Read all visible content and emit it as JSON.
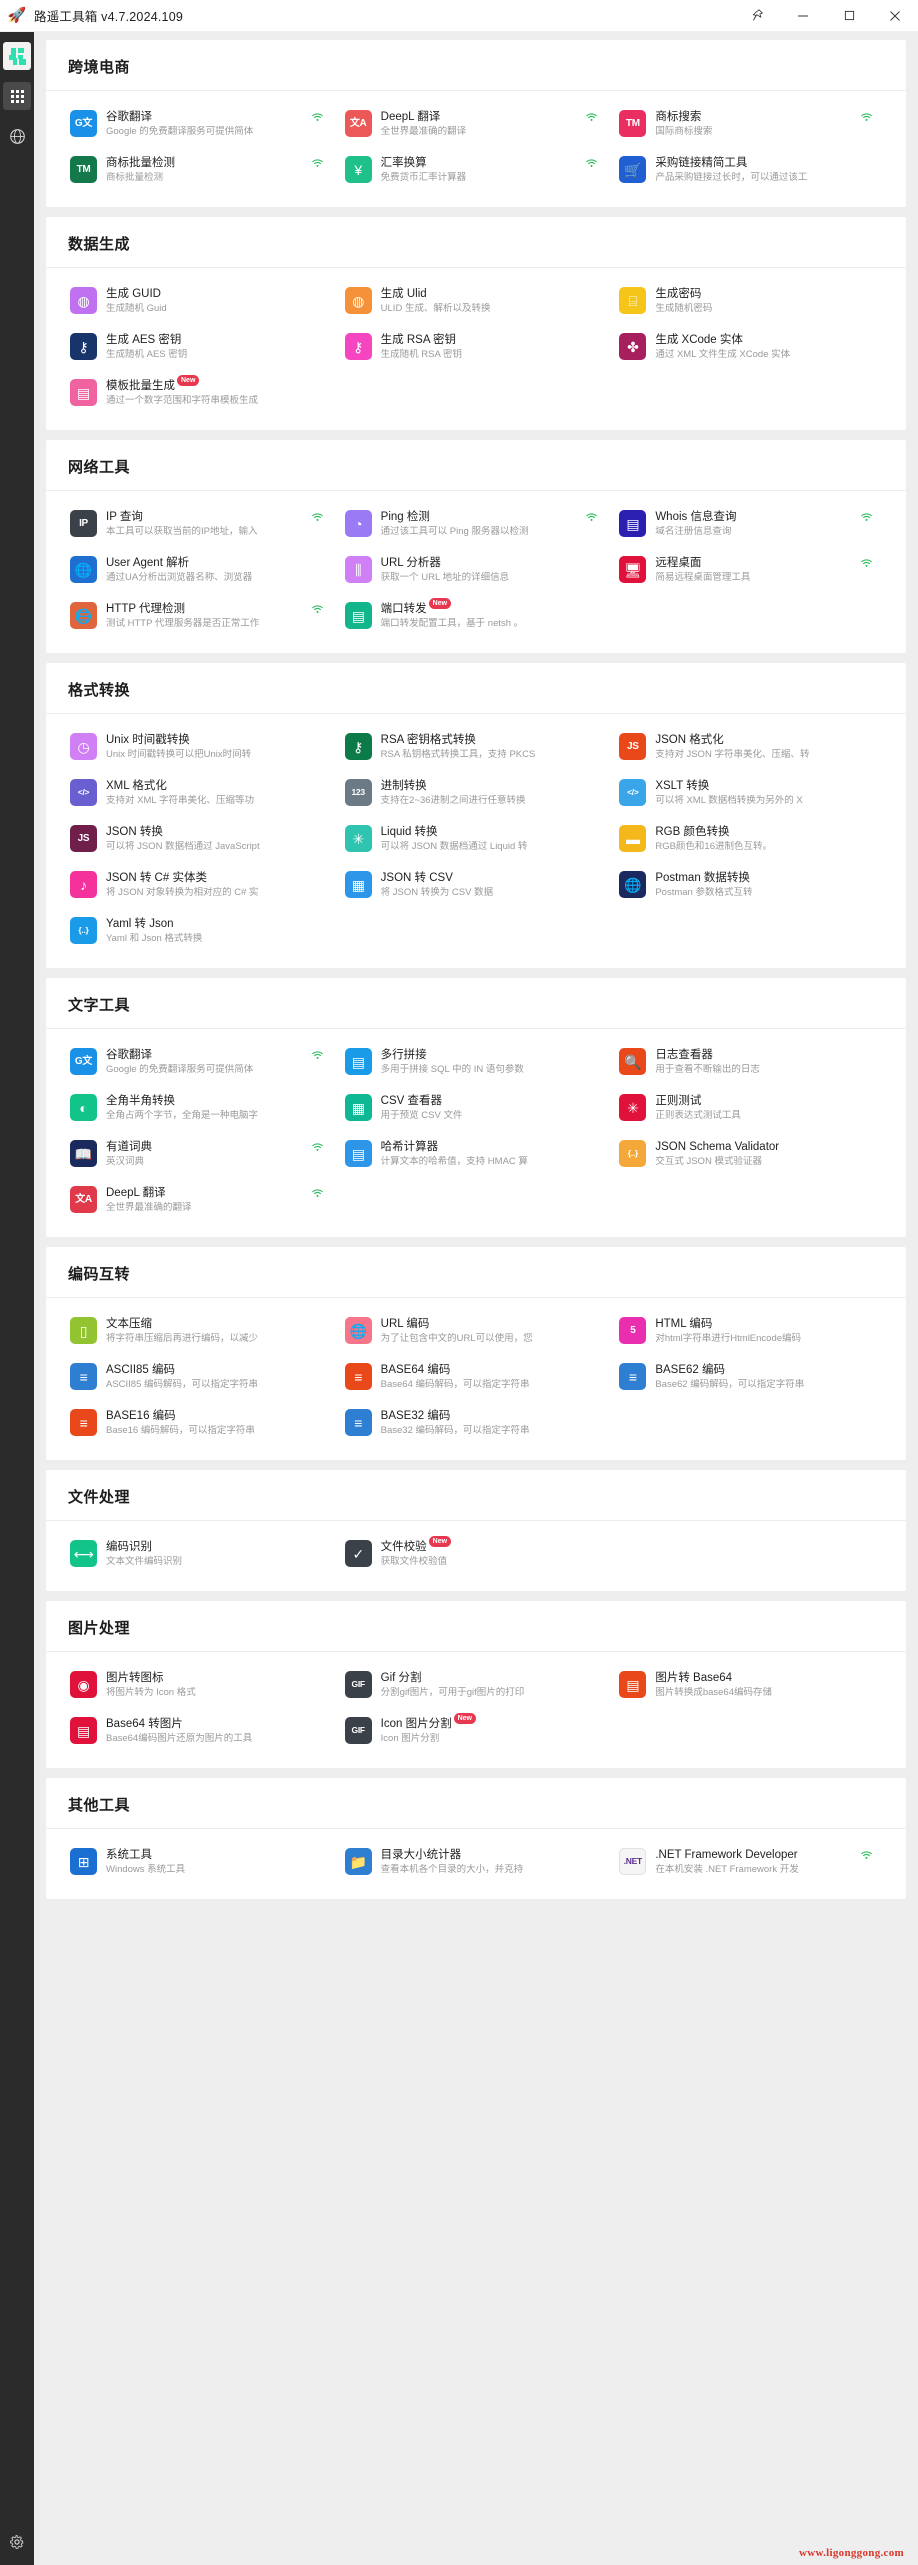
{
  "window": {
    "title": "路遥工具箱 v4.7.2024.109",
    "app_icon": "rocket-icon",
    "controls": {
      "pin": "pin-icon",
      "minimize": "minimize-icon",
      "maximize": "maximize-icon",
      "close": "close-icon"
    }
  },
  "sidebar": {
    "items": [
      {
        "name": "toolbox-logo",
        "icon": "puzzle-icon",
        "active": true
      },
      {
        "name": "all-tools",
        "icon": "grid-icon",
        "active": false
      },
      {
        "name": "web-tools",
        "icon": "globe-icon",
        "active": false
      }
    ],
    "settings": {
      "name": "settings",
      "icon": "gear-icon"
    }
  },
  "watermark": "www.ligonggong.com",
  "sections": [
    {
      "id": "cross-border-ecommerce",
      "title": "跨境电商",
      "cards": [
        {
          "title": "谷歌翻译",
          "desc": "Google 的免费翻译服务可提供简体",
          "icon": "google-translate-icon",
          "icon_text": "G文",
          "bg": "#1a91e6",
          "wifi": true
        },
        {
          "title": "DeepL 翻译",
          "desc": "全世界最准确的翻译",
          "icon": "translate-icon",
          "icon_text": "文A",
          "bg": "#ec5858",
          "wifi": true
        },
        {
          "title": "商标搜索",
          "desc": "国际商标搜索",
          "icon": "trademark-icon",
          "icon_text": "TM",
          "bg": "#ea2e62",
          "wifi": true
        },
        {
          "title": "商标批量检测",
          "desc": "商标批量检测",
          "icon": "trademark-batch-icon",
          "icon_text": "TM",
          "bg": "#13794a",
          "wifi": true
        },
        {
          "title": "汇率换算",
          "desc": "免费货币汇率计算器",
          "icon": "currency-yen-icon",
          "icon_text": "¥",
          "bg": "#1fc08a",
          "wifi": true
        },
        {
          "title": "采购链接精简工具",
          "desc": "产品采购链接过长时，可以通过该工",
          "icon": "shopping-cart-icon",
          "icon_text": "🛒",
          "bg": "#1f5fd1",
          "wifi": false
        }
      ]
    },
    {
      "id": "data-generation",
      "title": "数据生成",
      "cards": [
        {
          "title": "生成 GUID",
          "desc": "生成随机 Guid",
          "icon": "guid-icon",
          "icon_text": "◍",
          "bg": "#c071f0",
          "wifi": false
        },
        {
          "title": "生成 Ulid",
          "desc": "ULID 生成、解析以及转换",
          "icon": "ulid-icon",
          "icon_text": "◍",
          "bg": "#f59138",
          "wifi": false
        },
        {
          "title": "生成密码",
          "desc": "生成随机密码",
          "icon": "password-icon",
          "icon_text": "⌸",
          "bg": "#f5c519",
          "wifi": false
        },
        {
          "title": "生成 AES 密钥",
          "desc": "生成随机 AES 密钥",
          "icon": "aes-key-icon",
          "icon_text": "⚷",
          "bg": "#17346b",
          "wifi": false
        },
        {
          "title": "生成 RSA 密钥",
          "desc": "生成随机 RSA 密钥",
          "icon": "rsa-key-icon",
          "icon_text": "⚷",
          "bg": "#f545c0",
          "wifi": false
        },
        {
          "title": "生成 XCode 实体",
          "desc": "通过 XML 文件生成 XCode 实体",
          "icon": "xcode-entity-icon",
          "icon_text": "✤",
          "bg": "#a81f5e",
          "wifi": false
        },
        {
          "title": "模板批量生成",
          "desc": "通过一个数字范围和字符串模板生成",
          "icon": "template-batch-icon",
          "icon_text": "▤",
          "bg": "#f062a0",
          "wifi": false,
          "badge": "New"
        }
      ]
    },
    {
      "id": "network-tools",
      "title": "网络工具",
      "cards": [
        {
          "title": "IP 查询",
          "desc": "本工具可以获取当前的IP地址，输入",
          "icon": "ip-lookup-icon",
          "icon_text": "IP",
          "bg": "#3b4148",
          "wifi": true
        },
        {
          "title": "Ping 检测",
          "desc": "通过该工具可以 Ping 服务器以检测",
          "icon": "ping-icon",
          "icon_text": "◔",
          "bg": "#9a7bf5",
          "wifi": true
        },
        {
          "title": "Whois 信息查询",
          "desc": "域名注册信息查询",
          "icon": "whois-icon",
          "icon_text": "▤",
          "bg": "#2a1fb0",
          "wifi": true
        },
        {
          "title": "User Agent 解析",
          "desc": "通过UA分析出浏览器名称、浏览器",
          "icon": "user-agent-icon",
          "icon_text": "🌐",
          "bg": "#1f6fd1",
          "wifi": false
        },
        {
          "title": "URL 分析器",
          "desc": "获取一个 URL 地址的详细信息",
          "icon": "url-analyzer-icon",
          "icon_text": "⫼",
          "bg": "#d07ff5",
          "wifi": false
        },
        {
          "title": "远程桌面",
          "desc": "简易远程桌面管理工具",
          "icon": "remote-desktop-icon",
          "icon_text": "🖥",
          "bg": "#e0113a",
          "wifi": true
        },
        {
          "title": "HTTP 代理检测",
          "desc": "测试 HTTP 代理服务器是否正常工作",
          "icon": "http-proxy-icon",
          "icon_text": "🌐",
          "bg": "#e0643c",
          "wifi": true
        },
        {
          "title": "端口转发",
          "desc": "端口转发配置工具，基于 netsh 。",
          "icon": "port-forward-icon",
          "icon_text": "▤",
          "bg": "#13b58a",
          "wifi": false,
          "badge": "New"
        }
      ]
    },
    {
      "id": "format-conversion",
      "title": "格式转换",
      "cards": [
        {
          "title": "Unix 时间戳转换",
          "desc": "Unix 时间戳转换可以把Unix时间转",
          "icon": "clock-icon",
          "icon_text": "◷",
          "bg": "#d07ff5",
          "wifi": false
        },
        {
          "title": "RSA 密钥格式转换",
          "desc": "RSA 私钥格式转换工具，支持 PKCS",
          "icon": "rsa-format-icon",
          "icon_text": "⚷",
          "bg": "#0d7a4a",
          "wifi": false
        },
        {
          "title": "JSON 格式化",
          "desc": "支持对 JSON 字符串美化、压缩、转",
          "icon": "json-format-icon",
          "icon_text": "JS",
          "bg": "#e8481a",
          "wifi": false
        },
        {
          "title": "XML 格式化",
          "desc": "支持对 XML 字符串美化、压缩等功",
          "icon": "xml-format-icon",
          "icon_text": "</>",
          "bg": "#6a5fd1",
          "wifi": false
        },
        {
          "title": "进制转换",
          "desc": "支持在2~36进制之间进行任意转换",
          "icon": "radix-icon",
          "icon_text": "123",
          "bg": "#6b7a85",
          "wifi": false
        },
        {
          "title": "XSLT 转换",
          "desc": "可以将 XML 数据档转换为另外的 X",
          "icon": "xslt-icon",
          "icon_text": "</>",
          "bg": "#3aa5e8",
          "wifi": false
        },
        {
          "title": "JSON 转换",
          "desc": "可以将 JSON 数据档通过 JavaScript",
          "icon": "json-convert-icon",
          "icon_text": "JS",
          "bg": "#701f4a",
          "wifi": false
        },
        {
          "title": "Liquid 转换",
          "desc": "可以将 JSON 数据档通过 Liquid 转",
          "icon": "liquid-icon",
          "icon_text": "✳",
          "bg": "#2ec4b0",
          "wifi": false
        },
        {
          "title": "RGB 颜色转换",
          "desc": "RGB颜色和16进制色互转。",
          "icon": "rgb-color-icon",
          "icon_text": "▬",
          "bg": "#f5b81a",
          "wifi": false
        },
        {
          "title": "JSON 转 C# 实体类",
          "desc": "将 JSON 对象转换为相对应的 C# 实",
          "icon": "json-csharp-icon",
          "icon_text": "♪",
          "bg": "#f5319b",
          "wifi": false
        },
        {
          "title": "JSON 转 CSV",
          "desc": "将 JSON 转换为 CSV 数据",
          "icon": "json-csv-icon",
          "icon_text": "▦",
          "bg": "#2e96e8",
          "wifi": false
        },
        {
          "title": "Postman 数据转换",
          "desc": "Postman 参数格式互转",
          "icon": "postman-icon",
          "icon_text": "🌐",
          "bg": "#1a2a5e",
          "wifi": false
        },
        {
          "title": "Yaml 转 Json",
          "desc": "Yaml 和 Json 格式转换",
          "icon": "yaml-json-icon",
          "icon_text": "{..}",
          "bg": "#1a9be8",
          "wifi": false
        }
      ]
    },
    {
      "id": "text-tools",
      "title": "文字工具",
      "cards": [
        {
          "title": "谷歌翻译",
          "desc": "Google 的免费翻译服务可提供简体",
          "icon": "google-translate-icon",
          "icon_text": "G文",
          "bg": "#1a91e6",
          "wifi": true
        },
        {
          "title": "多行拼接",
          "desc": "多用于拼接 SQL 中的 IN 语句参数",
          "icon": "multiline-join-icon",
          "icon_text": "▤",
          "bg": "#1a9be8",
          "wifi": false
        },
        {
          "title": "日志查看器",
          "desc": "用于查看不断输出的日志",
          "icon": "log-viewer-icon",
          "icon_text": "🔍",
          "bg": "#e8481a",
          "wifi": false
        },
        {
          "title": "全角半角转换",
          "desc": "全角占两个字节，全角是一种电脑字",
          "icon": "fullwidth-icon",
          "icon_text": "◐",
          "bg": "#13c48a",
          "wifi": false
        },
        {
          "title": "CSV 查看器",
          "desc": "用于预览 CSV 文件",
          "icon": "csv-viewer-icon",
          "icon_text": "▦",
          "bg": "#0fb894",
          "wifi": false
        },
        {
          "title": "正则测试",
          "desc": "正则表达式测试工具",
          "icon": "regex-icon",
          "icon_text": "✳",
          "bg": "#e0113a",
          "wifi": false
        },
        {
          "title": "有道词典",
          "desc": "英汉词典",
          "icon": "dictionary-icon",
          "icon_text": "📖",
          "bg": "#1a2a5e",
          "wifi": true
        },
        {
          "title": "哈希计算器",
          "desc": "计算文本的哈希值，支持 HMAC 算",
          "icon": "hash-calc-icon",
          "icon_text": "▤",
          "bg": "#2e96e8",
          "wifi": false
        },
        {
          "title": "JSON Schema Validator",
          "desc": "交互式 JSON 模式验证器",
          "icon": "json-schema-icon",
          "icon_text": "{..}",
          "bg": "#f5a83a",
          "wifi": false
        },
        {
          "title": "DeepL 翻译",
          "desc": "全世界最准确的翻译",
          "icon": "translate-icon",
          "icon_text": "文A",
          "bg": "#e03a4a",
          "wifi": true
        }
      ]
    },
    {
      "id": "encoding-conversion",
      "title": "编码互转",
      "cards": [
        {
          "title": "文本压缩",
          "desc": "将字符串压缩后再进行编码，以减少",
          "icon": "text-compress-icon",
          "icon_text": "▯",
          "bg": "#92c432",
          "wifi": false
        },
        {
          "title": "URL 编码",
          "desc": "为了让包含中文的URL可以使用，您",
          "icon": "url-encode-icon",
          "icon_text": "🌐",
          "bg": "#f5768a",
          "wifi": false
        },
        {
          "title": "HTML 编码",
          "desc": "对html字符串进行HtmlEncode编码",
          "icon": "html-encode-icon",
          "icon_text": "5",
          "bg": "#ea2eb0",
          "wifi": false
        },
        {
          "title": "ASCII85 编码",
          "desc": "ASCII85 编码解码，可以指定字符串",
          "icon": "ascii85-icon",
          "icon_text": "≡",
          "bg": "#2e7fd1",
          "wifi": false
        },
        {
          "title": "BASE64 编码",
          "desc": "Base64 编码解码，可以指定字符串",
          "icon": "base64-icon",
          "icon_text": "≡",
          "bg": "#e8481a",
          "wifi": false
        },
        {
          "title": "BASE62 编码",
          "desc": "Base62 编码解码，可以指定字符串",
          "icon": "base62-icon",
          "icon_text": "≡",
          "bg": "#2e7fd1",
          "wifi": false
        },
        {
          "title": "BASE16 编码",
          "desc": "Base16 编码解码，可以指定字符串",
          "icon": "base16-icon",
          "icon_text": "≡",
          "bg": "#e8481a",
          "wifi": false
        },
        {
          "title": "BASE32 编码",
          "desc": "Base32 编码解码，可以指定字符串",
          "icon": "base32-icon",
          "icon_text": "≡",
          "bg": "#2e7fd1",
          "wifi": false
        }
      ]
    },
    {
      "id": "file-processing",
      "title": "文件处理",
      "cards": [
        {
          "title": "编码识别",
          "desc": "文本文件编码识别",
          "icon": "encoding-detect-icon",
          "icon_text": "⟷",
          "bg": "#13c48a",
          "wifi": false
        },
        {
          "title": "文件校验",
          "desc": "获取文件校验值",
          "icon": "file-checksum-icon",
          "icon_text": "✓",
          "bg": "#3b4148",
          "wifi": false,
          "badge": "New"
        }
      ]
    },
    {
      "id": "image-processing",
      "title": "图片处理",
      "cards": [
        {
          "title": "图片转图标",
          "desc": "将图片转为 Icon 格式",
          "icon": "image-to-icon-icon",
          "icon_text": "◉",
          "bg": "#e0113a",
          "wifi": false
        },
        {
          "title": "Gif 分割",
          "desc": "分割gif图片，可用于gif图片的打印",
          "icon": "gif-split-icon",
          "icon_text": "GIF",
          "bg": "#3b4148",
          "wifi": false
        },
        {
          "title": "图片转 Base64",
          "desc": "图片转换成base64编码存储",
          "icon": "image-base64-icon",
          "icon_text": "▤",
          "bg": "#e8481a",
          "wifi": false
        },
        {
          "title": "Base64 转图片",
          "desc": "Base64编码图片还原为图片的工具",
          "icon": "base64-image-icon",
          "icon_text": "▤",
          "bg": "#e0113a",
          "wifi": false
        },
        {
          "title": "Icon 图片分割",
          "desc": "Icon 图片分割",
          "icon": "icon-split-icon",
          "icon_text": "GIF",
          "bg": "#3b4148",
          "wifi": false,
          "badge": "New"
        }
      ]
    },
    {
      "id": "other-tools",
      "title": "其他工具",
      "cards": [
        {
          "title": "系统工具",
          "desc": "Windows 系统工具",
          "icon": "system-tools-icon",
          "icon_text": "⊞",
          "bg": "#1a6fd1",
          "wifi": false
        },
        {
          "title": "目录大小统计器",
          "desc": "查看本机各个目录的大小，并克持",
          "icon": "folder-size-icon",
          "icon_text": "📁",
          "bg": "#2e7fd1",
          "wifi": false
        },
        {
          "title": ".NET Framework Developer",
          "desc": "在本机安装 .NET Framework 开发",
          "icon": "dotnet-icon",
          "icon_text": ".NET",
          "bg": "#f5f5f5",
          "wifi": true
        }
      ]
    }
  ]
}
